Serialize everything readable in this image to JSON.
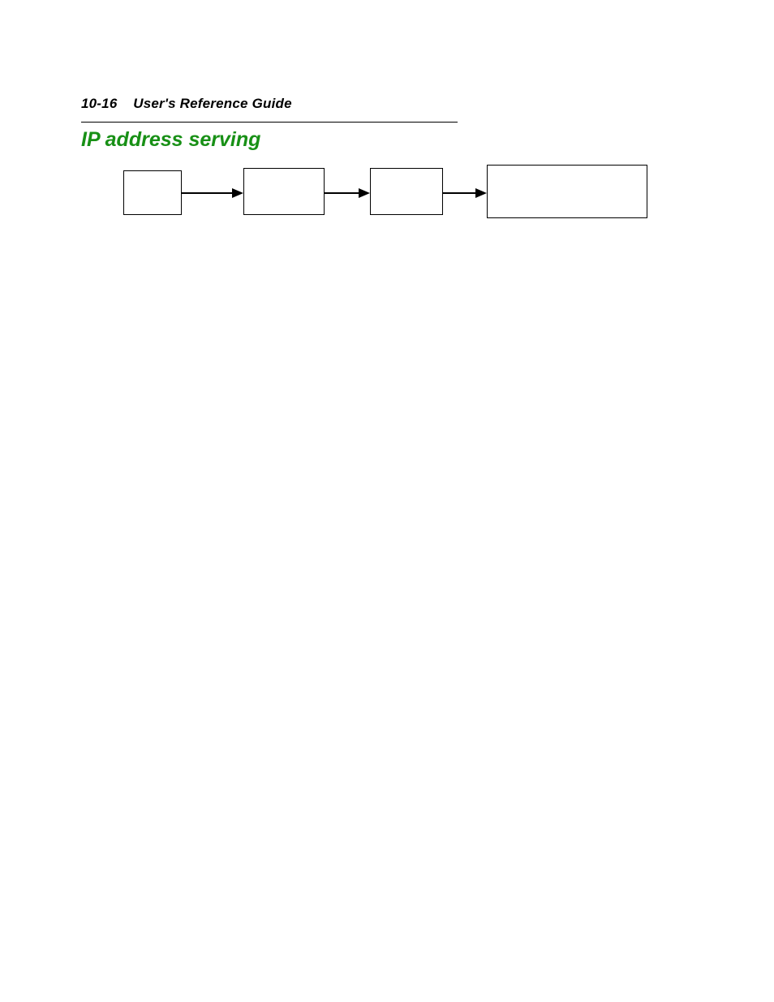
{
  "header": {
    "page_number": "10-16",
    "doc_title": "User's Reference Guide"
  },
  "section": {
    "title": "IP address serving"
  },
  "diagram": {
    "boxes": [
      {
        "label": ""
      },
      {
        "label": ""
      },
      {
        "label": ""
      },
      {
        "label": ""
      }
    ]
  }
}
